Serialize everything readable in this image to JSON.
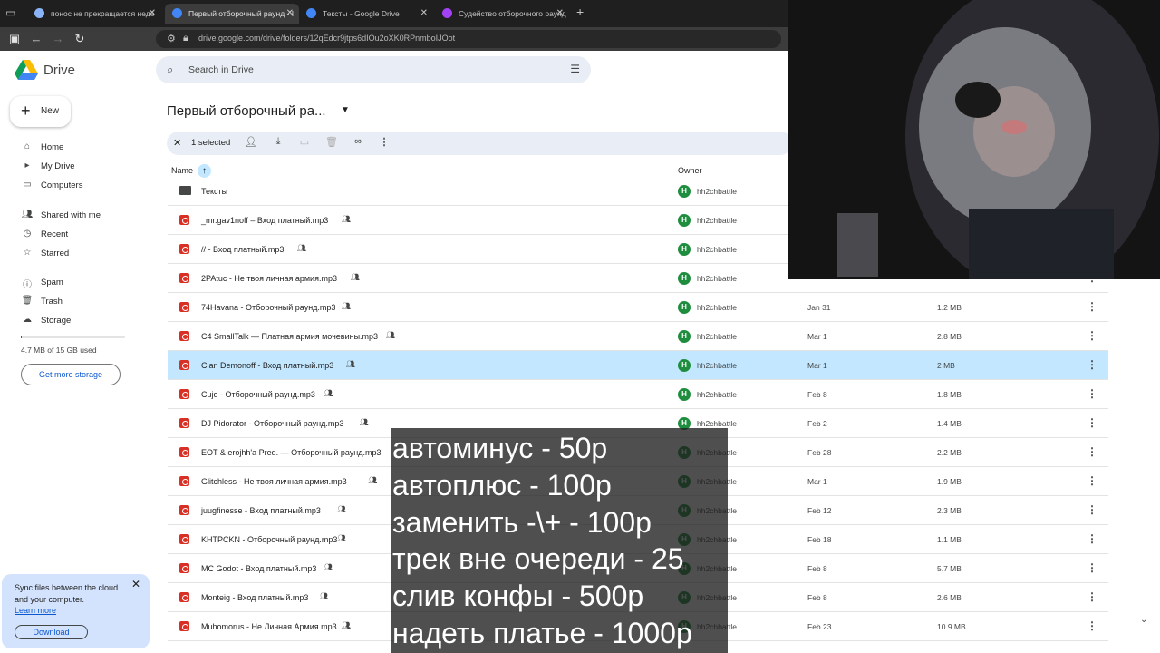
{
  "browser": {
    "tabs": [
      {
        "title": "понос не прекращается неде",
        "fav_color": "#8ab4f8"
      },
      {
        "title": "Первый отборочный раунд - I",
        "fav_color": "#4285f4"
      },
      {
        "title": "Тексты - Google Drive",
        "fav_color": "#4285f4"
      },
      {
        "title": "Судейство отборочного раунд",
        "fav_color": "#a142f4"
      }
    ],
    "url": "drive.google.com/drive/folders/12qEdcr9jtps6dIOu2oXK0RPnmboIJOot"
  },
  "drive": {
    "app_name": "Drive",
    "search_placeholder": "Search in Drive",
    "new_label": "New",
    "nav": [
      {
        "label": "Home",
        "icon": "home-icon"
      },
      {
        "label": "My Drive",
        "icon": "my-drive-icon"
      },
      {
        "label": "Computers",
        "icon": "computers-icon"
      },
      {
        "label": "Shared with me",
        "icon": "shared-icon"
      },
      {
        "label": "Recent",
        "icon": "clock-icon"
      },
      {
        "label": "Starred",
        "icon": "star-icon"
      },
      {
        "label": "Spam",
        "icon": "spam-icon"
      },
      {
        "label": "Trash",
        "icon": "trash-icon"
      },
      {
        "label": "Storage",
        "icon": "cloud-icon"
      }
    ],
    "storage_text": "4.7 MB of 15 GB used",
    "storage_fraction": 0.0003,
    "get_storage_label": "Get more storage",
    "sync_message": "Sync files between the cloud and your computer.",
    "sync_learn_more": "Learn more",
    "sync_download": "Download",
    "folder_title": "Первый отборочный ра...",
    "selection_count": "1 selected",
    "columns": {
      "name": "Name",
      "owner": "Owner"
    },
    "rows": [
      {
        "name": "Тексты",
        "type": "folder",
        "shared": false,
        "owner": "hh2chbattle",
        "date": "",
        "size": ""
      },
      {
        "name": "_mr.gav1noff – Вход платный.mp3",
        "type": "audio",
        "shared": true,
        "owner": "hh2chbattle",
        "date": "",
        "size": ""
      },
      {
        "name": "// - Вход платный.mp3",
        "type": "audio",
        "shared": true,
        "owner": "hh2chbattle",
        "date": "",
        "size": ""
      },
      {
        "name": "2PAtuc - Не твоя личная армия.mp3",
        "type": "audio",
        "shared": true,
        "owner": "hh2chbattle",
        "date": "",
        "size": ""
      },
      {
        "name": "74Havana - Отборочный раунд.mp3",
        "type": "audio",
        "shared": true,
        "owner": "hh2chbattle",
        "date": "Jan 31",
        "size": "1.2 MB"
      },
      {
        "name": "C4 SmallTalk — Платная армия мочевины.mp3",
        "type": "audio",
        "shared": true,
        "owner": "hh2chbattle",
        "date": "Mar 1",
        "size": "2.8 MB"
      },
      {
        "name": "Clan Demonoff - Вход платный.mp3",
        "type": "audio",
        "shared": true,
        "owner": "hh2chbattle",
        "date": "Mar 1",
        "size": "2 MB",
        "selected": true
      },
      {
        "name": "Cujo - Отборочный раунд.mp3",
        "type": "audio",
        "shared": true,
        "owner": "hh2chbattle",
        "date": "Feb 8",
        "size": "1.8 MB"
      },
      {
        "name": "DJ Pidorator - Отборочный раунд.mp3",
        "type": "audio",
        "shared": true,
        "owner": "hh2chbattle",
        "date": "Feb 2",
        "size": "1.4 MB"
      },
      {
        "name": "EOT & erojhh'a Pred. — Отборочный раунд.mp3",
        "type": "audio",
        "shared": false,
        "owner": "hh2chbattle",
        "date": "Feb 28",
        "size": "2.2 MB"
      },
      {
        "name": "Glitchless - Не твоя личная армия.mp3",
        "type": "audio",
        "shared": true,
        "owner": "hh2chbattle",
        "date": "Mar 1",
        "size": "1.9 MB"
      },
      {
        "name": "juugfinesse - Вход платный.mp3",
        "type": "audio",
        "shared": true,
        "owner": "hh2chbattle",
        "date": "Feb 12",
        "size": "2.3 MB"
      },
      {
        "name": "KHTPCKN - Отборочный раунд.mp3",
        "type": "audio",
        "shared": true,
        "owner": "hh2chbattle",
        "date": "Feb 18",
        "size": "1.1 MB"
      },
      {
        "name": "MC Godot - Вход платный.mp3",
        "type": "audio",
        "shared": true,
        "owner": "hh2chbattle",
        "date": "Feb 8",
        "size": "5.7 MB"
      },
      {
        "name": "Monteig - Вход платный.mp3",
        "type": "audio",
        "shared": true,
        "owner": "hh2chbattle",
        "date": "Feb 8",
        "size": "2.6 MB"
      },
      {
        "name": "Muhomorus - Не Личная Армия.mp3",
        "type": "audio",
        "shared": true,
        "owner": "hh2chbattle",
        "date": "Feb 23",
        "size": "10.9 MB"
      }
    ]
  },
  "caption": [
    "автоминус - 50р",
    "автоплюс - 100р",
    "заменить -\\+ - 100р",
    "трек вне очереди - 25",
    "слив конфы - 500р",
    "надеть платье - 1000р"
  ],
  "colors": {
    "accent": "#0b57d0",
    "selected_row": "#c2e7ff",
    "owner_avatar": "#1e8e3e",
    "audio_icon": "#d93025"
  }
}
